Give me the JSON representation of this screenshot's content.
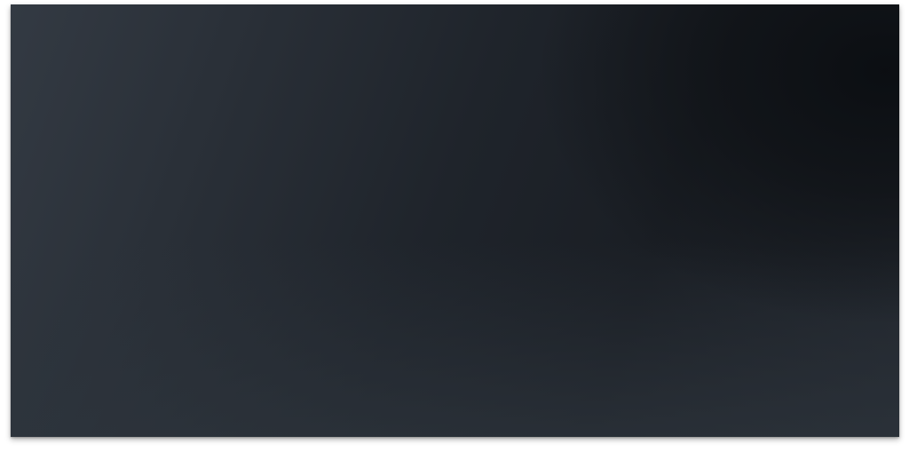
{
  "screen": {
    "background_color": "#ffffff",
    "panel_colors": [
      "#333a43",
      "#1f242b",
      "#0b0e12",
      "#2d343c"
    ]
  }
}
